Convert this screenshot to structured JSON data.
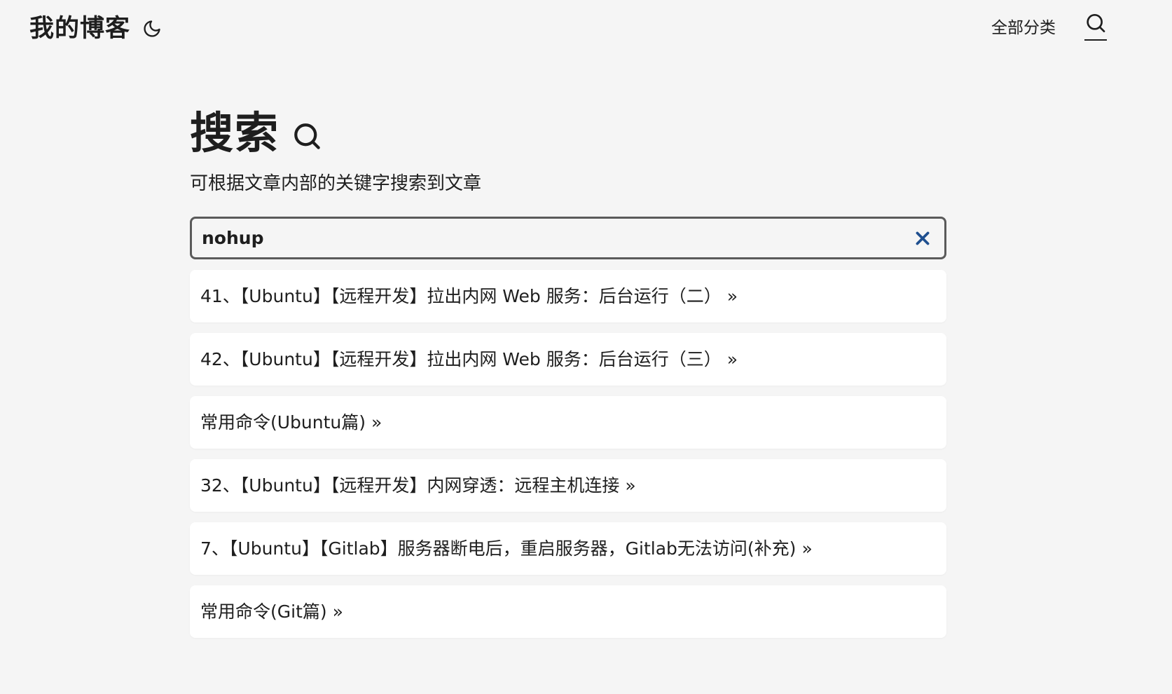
{
  "header": {
    "logo": "我的博客",
    "nav_link": "全部分类",
    "icons": {
      "theme": "moon-icon",
      "search": "search-icon"
    }
  },
  "main": {
    "title": "搜索",
    "description": "可根据文章内部的关键字搜索到文章",
    "search": {
      "value": "nohup",
      "clear_icon": "close-icon",
      "clear_color": "#1f4f8f"
    },
    "results": [
      {
        "title": "41、【Ubuntu】【远程开发】拉出内网 Web 服务：后台运行（二）",
        "arrow": "»"
      },
      {
        "title": "42、【Ubuntu】【远程开发】拉出内网 Web 服务：后台运行（三）",
        "arrow": "»"
      },
      {
        "title": "常用命令(Ubuntu篇)",
        "arrow": "»"
      },
      {
        "title": "32、【Ubuntu】【远程开发】内网穿透：远程主机连接",
        "arrow": "»"
      },
      {
        "title": "7、【Ubuntu】【Gitlab】服务器断电后，重启服务器，Gitlab无法访问(补充)",
        "arrow": "»"
      },
      {
        "title": "常用命令(Git篇)",
        "arrow": "»"
      }
    ]
  },
  "colors": {
    "background": "#f5f5f5",
    "text": "#1e1e1e",
    "card": "#ffffff",
    "input_border": "#5a5a5a"
  }
}
